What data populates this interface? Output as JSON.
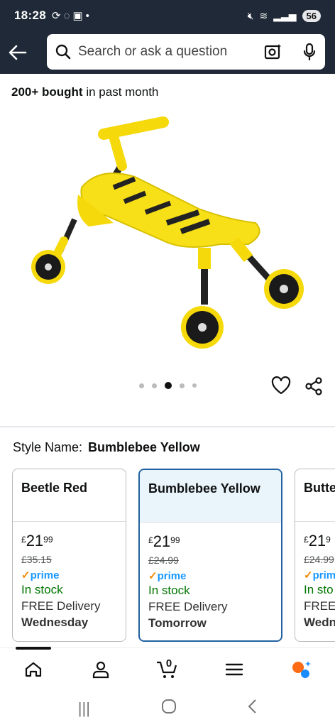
{
  "status": {
    "time": "18:28",
    "battery": "56"
  },
  "search": {
    "placeholder": "Search or ask a question"
  },
  "product": {
    "bought_bold": "200+ bought",
    "bought_rest": " in past month",
    "image_count": 5,
    "active_image": 3
  },
  "style": {
    "label": "Style Name:",
    "value": "Bumblebee Yellow"
  },
  "swatches": [
    {
      "title": "Beetle Red",
      "price_currency": "£",
      "price_whole": "21",
      "price_fraction": "99",
      "was": "£35.15",
      "prime": "prime",
      "stock": "In stock",
      "delivery": "FREE Delivery",
      "day": "Wednesday"
    },
    {
      "title": "Bumblebee Yellow",
      "price_currency": "£",
      "price_whole": "21",
      "price_fraction": "99",
      "was": "£24.99",
      "prime": "prime",
      "stock": "In stock",
      "delivery": "FREE Delivery",
      "day": "Tomorrow"
    },
    {
      "title": "Butte",
      "price_currency": "£",
      "price_whole": "21",
      "price_fraction": "9",
      "was": "£24.99",
      "prime": "prim",
      "stock": "In sto",
      "delivery": "FREE",
      "day": "Wedn"
    }
  ],
  "cart": {
    "count": "0"
  },
  "colors": {
    "header": "#1f2937",
    "selected_border": "#2162a1",
    "stock_green": "#007600",
    "prime_blue": "#1a98ff"
  }
}
